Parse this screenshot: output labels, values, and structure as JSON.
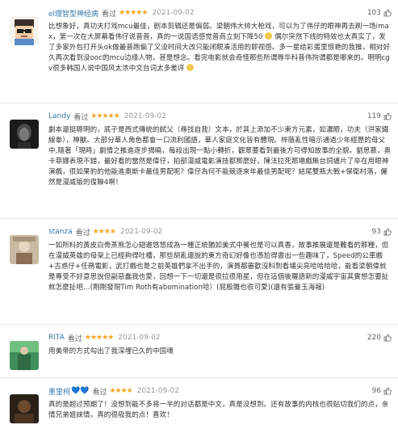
{
  "reviews": [
    {
      "username": "el理智型神经病",
      "badges": "",
      "status": "看过",
      "stars": "★★★★★",
      "date": "2021-09-02",
      "votes": "103",
      "text": "比想象好，真功夫打戏mcu最佳，剧本剪辑还是偏弱。梁朝伟大帅大枪戏，可以为了伟仔的眼神再去刷一场imax，第一次在大屏幕看伟仔说普普，真的一说国语感觉普商立刻下降50",
      "text2": "偶尔突然下线的特效也太真实了，发了多家外包打开头ok做最普跑偏了又没时间大改只能闭眼凑活用的即视感。多一星给彩蛋里惊艳的我推，相对好久再次看到没ooc的mcu边缘人物，甚是想念。看完电影就会奇怪那些所谓辱华科普伟拘谓都是哪来的。明明cgv很多韩国人说中国风太浓中文台词太多差评"
    },
    {
      "username": "Landy",
      "badges": "",
      "status": "看过",
      "stars": "★★★★★",
      "date": "2021-09-02",
      "votes": "119",
      "text": "劇本還挺聰明的，底子是西式傳統的弑父（尋找自我）文本，於其上添加不少東方元素，如濃眼，功夫（洪家鐵線拳），神獸。大部分華人角色都會一口流利國語，華人家庭文化皆有體現。梓蔭亂性暗示通過少年經歷的母父中,隨著「現時」劇情之推進逐步揭曉，每段出現一點小轉折，觀眾要看到最後方可得知故事的全貌。劉思慕，奧卡菲娜表現不錯，最好看的當然是偉仔，拍部漫威電影演技都那麼好，陳法拉死那場戲無台詞纏片了卒在用眼神演戲，很如果豹的他能進奧斯卡最佳男配呢？偉仔為何不能競逐來年最佳男配呢？結尾雙瓶大戰+保衛村落，儼然是漫威版的復聯4啊！",
      "text2": ""
    },
    {
      "username": "stanza",
      "badges": "",
      "status": "看过",
      "stars": "★★★★",
      "date": "2021-09-02",
      "votes": "93",
      "text": "一如所料的黃皮白骨蒸熊怎心翅邀悠悠成為一種正統猶如美式中餐也是可以真香，故事推展還是難看的那種，但在漫威英雄的母架上已經夠得吐槽，那些胡亂還說的東方奇幻好像也憑尬得書出一些趣味了，Speed的公車戲+古惑仔+任務電影，武打戲也是之前英雄們拿不出手的，演員都審歡沒料到看埔尖亮哈哈哈哈，能看梁朝偉就是專受不好意思說但副惡蠢我也愛，回想一下一切還是很拉很用星，但在這個後羅語新的漫威宇宙其實想怎要扯就怎麼扯吧…(剛剛發現Tim Roth有abomination哈）(屁股雜也很可愛)(還有張曼玉海報)",
      "text2": ""
    },
    {
      "username": "RITA",
      "badges": "",
      "status": "看过",
      "stars": "★★★★★",
      "date": "2021-09-02",
      "votes": "220",
      "text": "用美帝的方式勾出了我深埋已久的中国魂",
      "text2": ""
    },
    {
      "username": "墨里柯",
      "badges": "💙💙",
      "status": "看过",
      "stars": "★★★★",
      "date": "2021-09-02",
      "votes": "96",
      "text": "真的是超过预期了！没想到能不多将一半的对话都是中文，真是没想到。还有故事的内核也很贴切我们的点，亲情兄弟姐妹情，真的很吸我的点！喜欢！",
      "text2": ""
    }
  ]
}
